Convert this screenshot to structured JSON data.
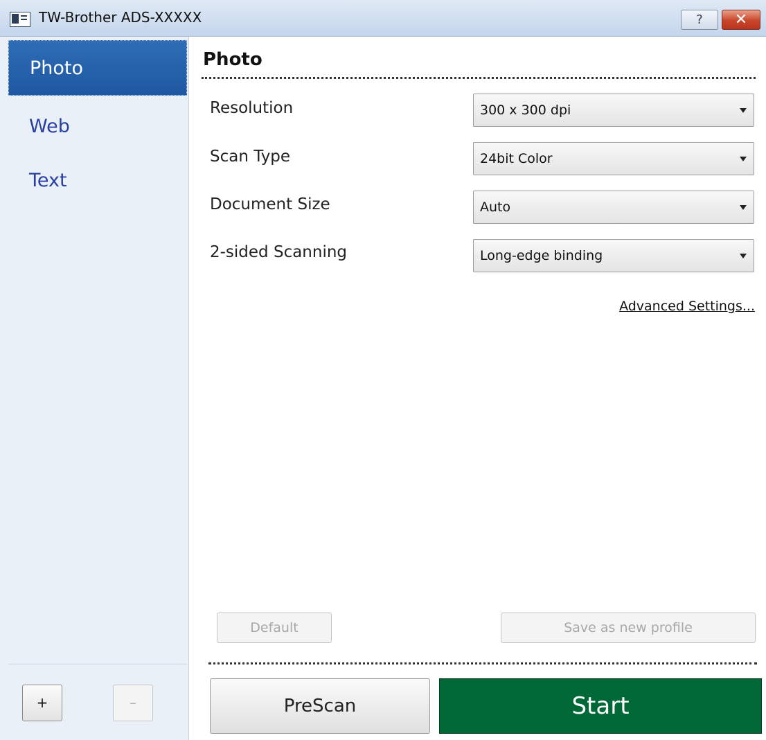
{
  "window": {
    "title": "TW-Brother ADS-XXXXX",
    "help_label": "?",
    "close_label": "✕"
  },
  "sidebar": {
    "items": [
      {
        "label": "Photo",
        "active": true
      },
      {
        "label": "Web",
        "active": false
      },
      {
        "label": "Text",
        "active": false
      }
    ],
    "add_label": "+",
    "remove_label": "–"
  },
  "main": {
    "section_title": "Photo",
    "settings": [
      {
        "label": "Resolution",
        "value": "300 x 300 dpi"
      },
      {
        "label": "Scan Type",
        "value": "24bit Color"
      },
      {
        "label": "Document Size",
        "value": "Auto"
      },
      {
        "label": "2-sided Scanning",
        "value": "Long-edge binding"
      }
    ],
    "advanced_link": "Advanced Settings...",
    "default_label": "Default",
    "save_profile_label": "Save as new profile",
    "prescan_label": "PreScan",
    "start_label": "Start"
  },
  "colors": {
    "start_button": "#006837",
    "sidebar_active": "#1f58a2",
    "sidebar_link": "#2a3fa3"
  }
}
